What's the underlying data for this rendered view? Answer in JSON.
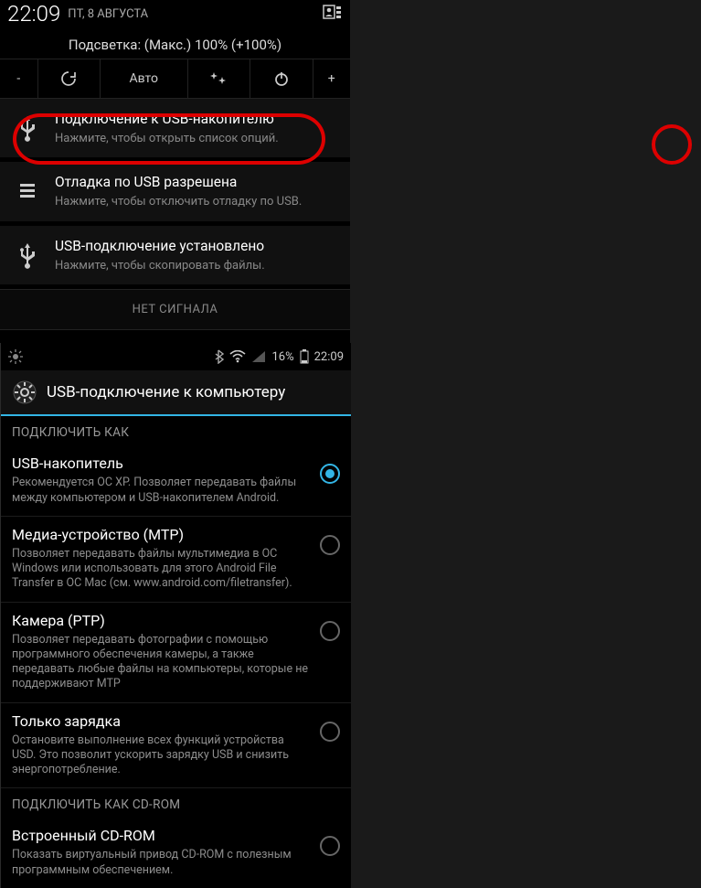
{
  "left": {
    "time": "22:09",
    "date": "ПТ, 8 АВГУСТА",
    "brightness_text": "Подсветка: (Макс.) 100% (+100%)",
    "toggles": {
      "minus": "-",
      "auto_label": "Авто",
      "plus": "+"
    },
    "notifications": [
      {
        "icon": "usb-icon",
        "title": "Подключение к USB-накопителю",
        "subtitle": "Нажмите, чтобы открыть список опций."
      },
      {
        "icon": "bars-icon",
        "title": "Отладка по USB разрешена",
        "subtitle": "Нажмите, чтобы отключить отладку по USB."
      },
      {
        "icon": "usb-icon",
        "title": "USB-подключение установлено",
        "subtitle": "Нажмите, чтобы скопировать файлы."
      }
    ],
    "no_signal": "НЕТ СИГНАЛА"
  },
  "right": {
    "status": {
      "battery_pct": "16%",
      "time": "22:09"
    },
    "header_title": "USB-подключение к компьютеру",
    "section1": "ПОДКЛЮЧИТЬ КАК",
    "options": [
      {
        "title": "USB-накопитель",
        "subtitle": "Рекомендуется ОС XP. Позволяет передавать файлы между компьютером и USB-накопителем Android.",
        "checked": true
      },
      {
        "title": "Медиа-устройство (MTP)",
        "subtitle": "Позволяет передавать файлы мультимедиа в ОС Windows или использовать для этого Android File Transfer в ОС Mac (см. www.android.com/filetransfer).",
        "checked": false
      },
      {
        "title": "Камера (PTP)",
        "subtitle": "Позволяет передавать фотографии с помощью программного обеспечения камеры, а также передавать любые файлы на компьютеры, которые не поддерживают MTP",
        "checked": false
      },
      {
        "title": "Только зарядка",
        "subtitle": "Остановите выполнение всех функций устройства USD. Это позволит ускорить зарядку USB и снизить энергопотребление.",
        "checked": false
      }
    ],
    "section2": "ПОДКЛЮЧИТЬ КАК CD-ROM",
    "cdrom_option": {
      "title": "Встроенный CD-ROM",
      "subtitle": "Показать виртуальный привод CD-ROM с полезным программным обеспечением.",
      "checked": false
    }
  }
}
